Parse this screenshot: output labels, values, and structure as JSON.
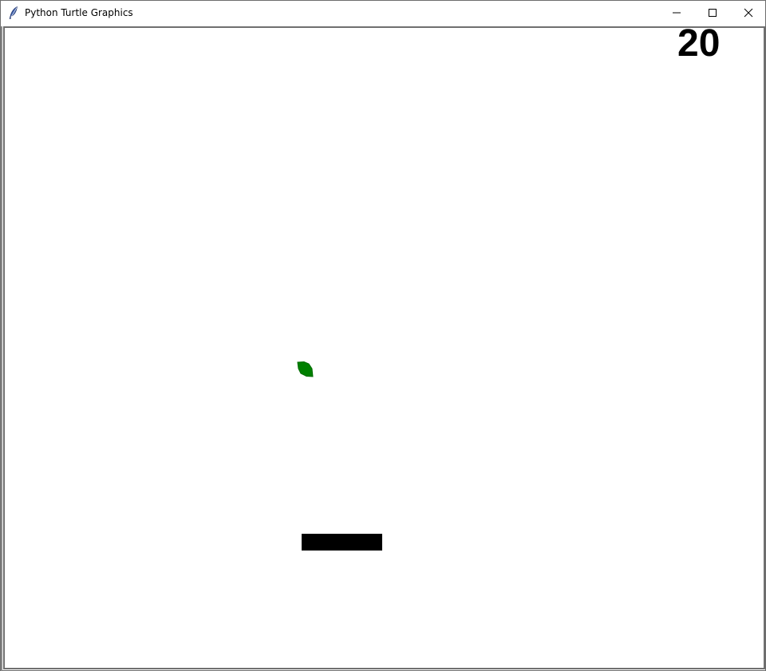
{
  "window": {
    "title": "Python Turtle Graphics",
    "icon": "feather-icon",
    "controls": [
      "minimize-icon",
      "maximize-icon",
      "close-icon"
    ]
  },
  "game": {
    "score": "20",
    "colors": {
      "background": "#ffffff",
      "ball": "#008000",
      "paddle": "#000000",
      "score": "#000000"
    }
  }
}
